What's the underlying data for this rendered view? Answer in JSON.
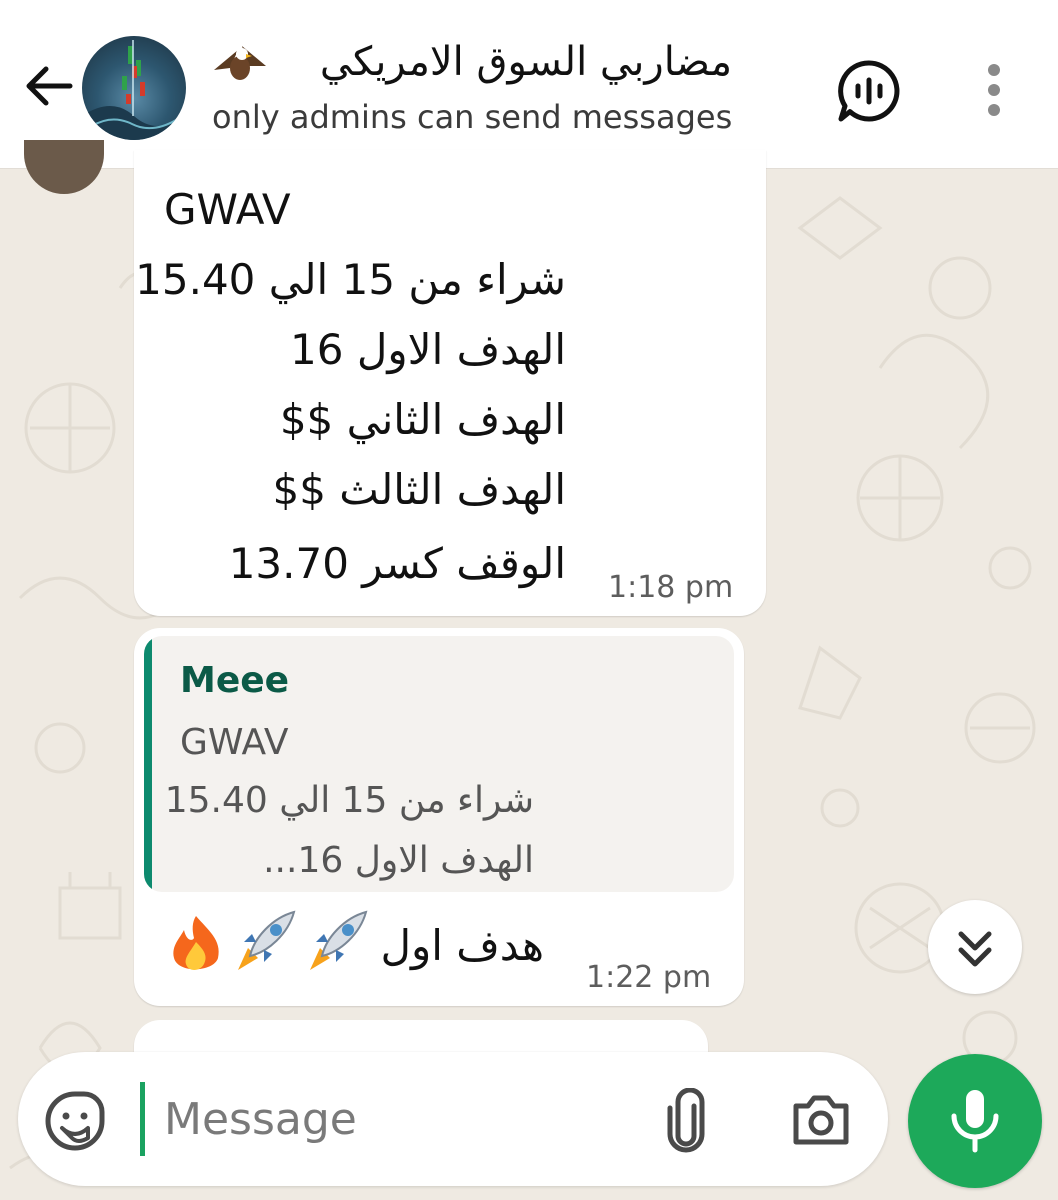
{
  "header": {
    "title": "مضاربي السوق الامريكي",
    "subtitle": "only admins can send messages"
  },
  "messages": [
    {
      "lines": [
        "GWAV",
        "شراء من 15 الي 15.40",
        "الهدف الاول 16",
        "الهدف الثاني $$",
        "الهدف الثالث $$",
        "الوقف كسر 13.70"
      ],
      "time": "1:18 pm"
    },
    {
      "quoted": {
        "author": "Meee",
        "lines": [
          "GWAV",
          "شراء من 15 الي 15.40",
          "الهدف الاول 16..."
        ]
      },
      "text": "هدف اول",
      "time": "1:22 pm"
    }
  ],
  "composer": {
    "placeholder": "Message"
  },
  "colors": {
    "accent_green": "#1da95a",
    "quote_bar": "#0d8a6e",
    "wallpaper": "#efeae2"
  }
}
